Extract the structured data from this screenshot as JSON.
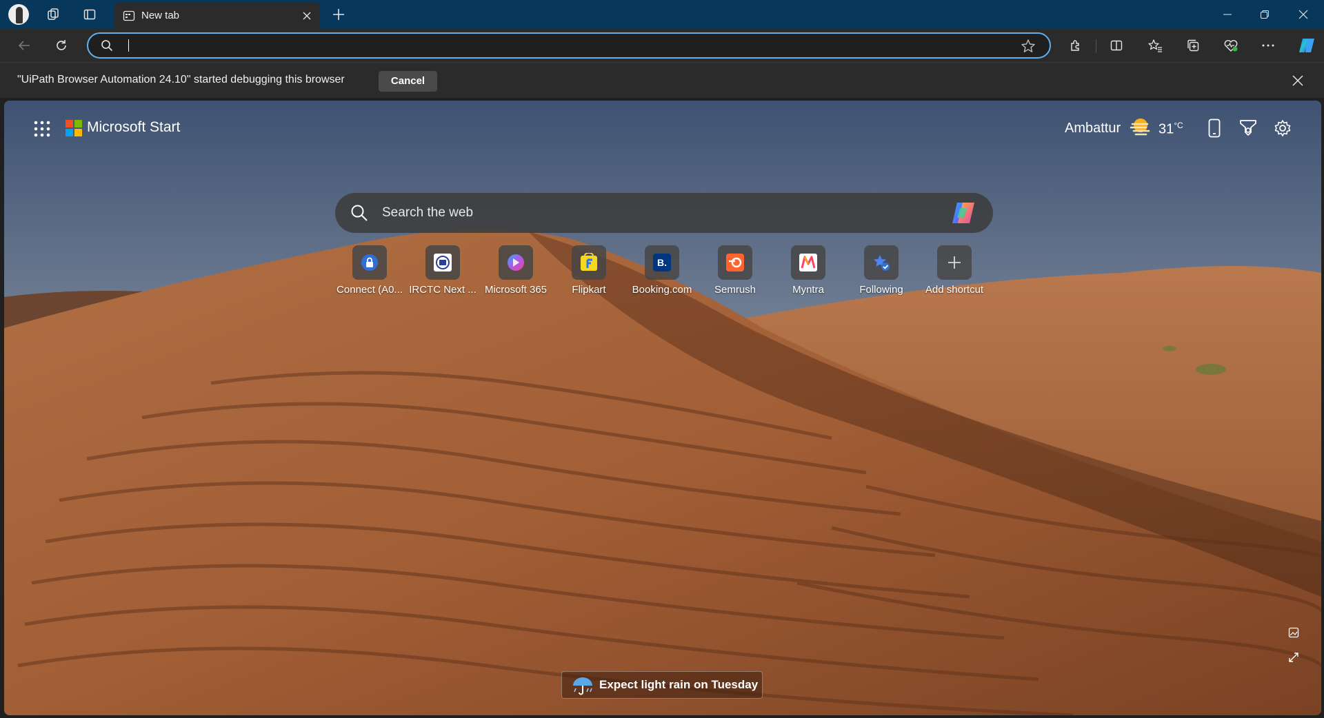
{
  "tabs": [
    {
      "title": "New tab"
    }
  ],
  "omnibox": {
    "value": "",
    "placeholder": ""
  },
  "infobar": {
    "message": "\"UiPath Browser Automation 24.10\" started debugging this browser",
    "cancel_label": "Cancel"
  },
  "header": {
    "brand": "Microsoft Start",
    "weather": {
      "location": "Ambattur",
      "temp": "31",
      "unit": "°C"
    }
  },
  "search": {
    "placeholder": "Search the web"
  },
  "shortcuts": [
    {
      "label": "Connect (A0...",
      "icon": "lock-icon"
    },
    {
      "label": "IRCTC Next ...",
      "icon": "irctc-icon"
    },
    {
      "label": "Microsoft 365",
      "icon": "microsoft-365-icon"
    },
    {
      "label": "Flipkart",
      "icon": "flipkart-icon"
    },
    {
      "label": "Booking.com",
      "icon": "booking-icon"
    },
    {
      "label": "Semrush",
      "icon": "semrush-icon"
    },
    {
      "label": "Myntra",
      "icon": "myntra-icon"
    },
    {
      "label": "Following",
      "icon": "following-icon"
    },
    {
      "label": "Add shortcut",
      "icon": "plus-icon"
    }
  ],
  "weather_banner": {
    "text": "Expect light rain on Tuesday"
  },
  "colors": {
    "titlebar": "#07375a",
    "toolbar": "#2b2b2b",
    "omnibox_focus": "#5fb2f2",
    "booking_blue": "#003580",
    "semrush_orange": "#ff642d",
    "flipkart_yellow": "#f8d81c"
  }
}
